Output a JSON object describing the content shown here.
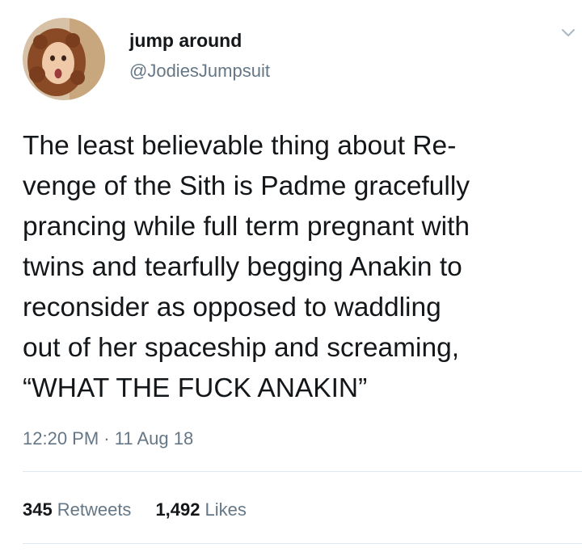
{
  "tweet": {
    "display_name": "jump around",
    "handle": "@JodiesJumpsuit",
    "text": "The least believable thing about Re-\nvenge of the Sith is Padme gracefully\nprancing while full term pregnant with\ntwins and tearfully begging Anakin to\nreconsider as opposed to waddling\nout of her spaceship and screaming,\n“WHAT THE FUCK ANAKIN”",
    "timestamp": "12:20 PM · 11 Aug 18",
    "retweets_count": "345",
    "retweets_label": "Retweets",
    "likes_count": "1,492",
    "likes_label": "Likes"
  },
  "icons": {
    "menu": "chevron-down-icon",
    "avatar": "avatar"
  },
  "colors": {
    "text": "#14171a",
    "secondary": "#657786",
    "divider": "#e1e8ed"
  }
}
